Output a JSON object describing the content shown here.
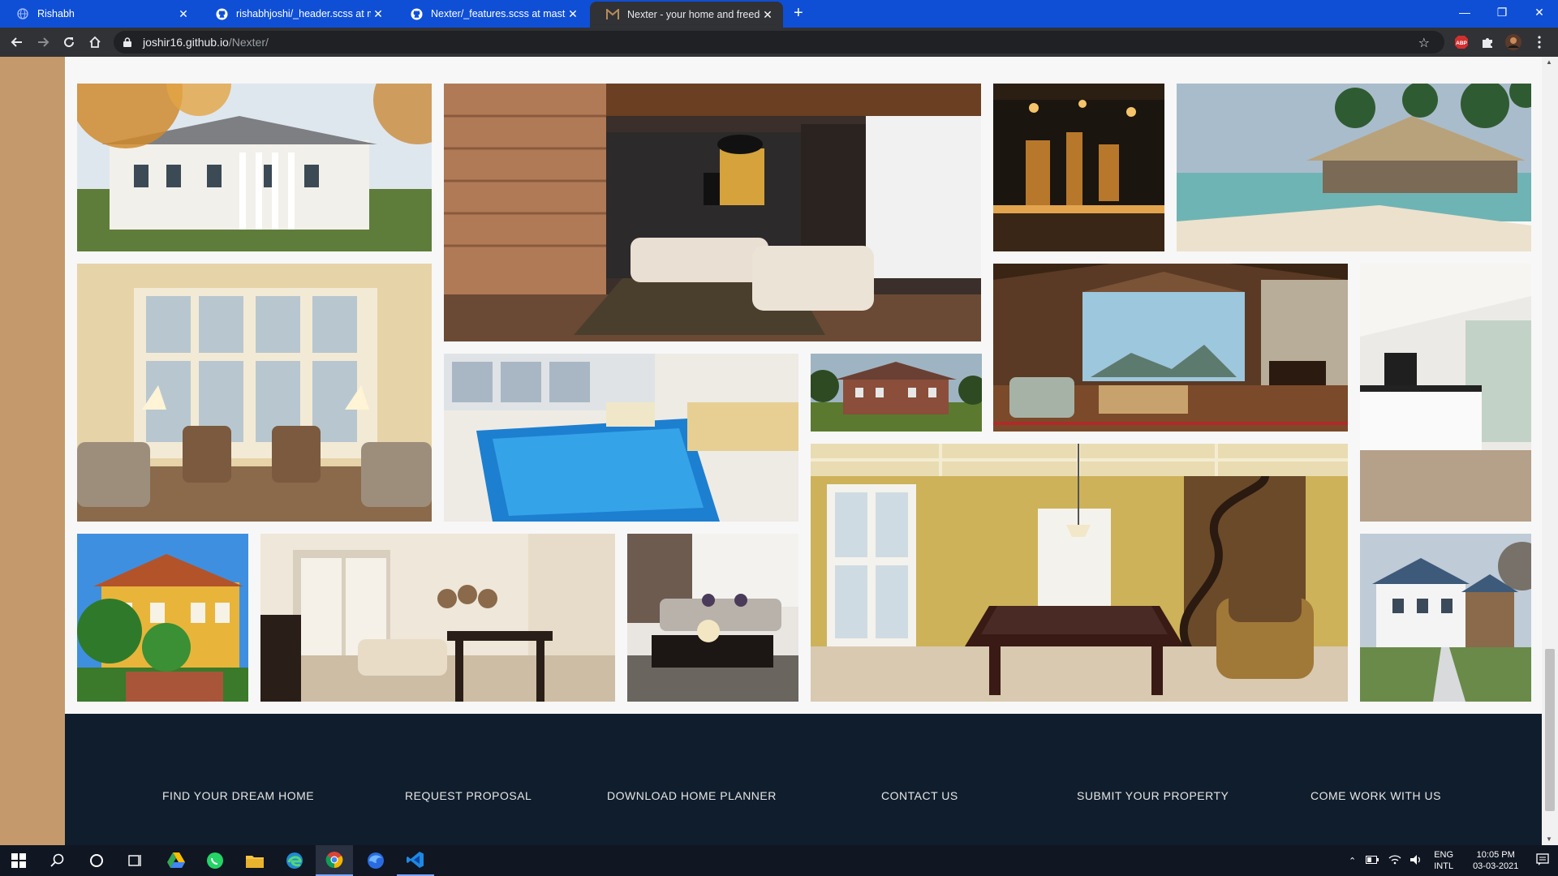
{
  "browser": {
    "tabs": [
      {
        "title": "Rishabh",
        "favicon": "globe-icon"
      },
      {
        "title": "rishabhjoshi/_header.scss at mas",
        "favicon": "github-icon"
      },
      {
        "title": "Nexter/_features.scss at master ·",
        "favicon": "github-icon"
      },
      {
        "title": "Nexter - your home and freedom",
        "favicon": "nexter-icon",
        "active": true
      }
    ],
    "url_host": "joshir16.github.io",
    "url_path": "/Nexter/",
    "extensions": [
      "ABP"
    ]
  },
  "gallery": {
    "images": [
      {
        "name": "gallery-image-1",
        "subject": "colonial-house-autumn"
      },
      {
        "name": "gallery-image-2",
        "subject": "living-room-wood-ceiling"
      },
      {
        "name": "gallery-image-3",
        "subject": "dark-bar-interior"
      },
      {
        "name": "gallery-image-4",
        "subject": "beach-resort"
      },
      {
        "name": "gallery-image-5",
        "subject": "sunroom-armchairs"
      },
      {
        "name": "gallery-image-6",
        "subject": "indoor-pool"
      },
      {
        "name": "gallery-image-7",
        "subject": "brick-house"
      },
      {
        "name": "gallery-image-8",
        "subject": "great-room-stone-fireplace"
      },
      {
        "name": "gallery-image-9",
        "subject": "white-kitchen"
      },
      {
        "name": "gallery-image-10",
        "subject": "billiard-room"
      },
      {
        "name": "gallery-image-11",
        "subject": "mediterranean-villa"
      },
      {
        "name": "gallery-image-12",
        "subject": "dining-living-room"
      },
      {
        "name": "gallery-image-13",
        "subject": "modern-lounge"
      },
      {
        "name": "gallery-image-14",
        "subject": "white-house-driveway"
      }
    ]
  },
  "footer": {
    "links": [
      "FIND YOUR DREAM HOME",
      "REQUEST PROPOSAL",
      "DOWNLOAD HOME PLANNER",
      "CONTACT US",
      "SUBMIT YOUR PROPERTY",
      "COME WORK WITH US"
    ]
  },
  "taskbar": {
    "apps": [
      "start-icon",
      "search-icon",
      "cortana-icon",
      "task-view-icon",
      "google-drive-icon",
      "whatsapp-icon",
      "file-explorer-icon",
      "edge-icon",
      "chrome-icon",
      "firefox-icon",
      "vscode-icon"
    ],
    "lang_line1": "ENG",
    "lang_line2": "INTL",
    "time": "10:05 PM",
    "date": "03-03-2021"
  },
  "colors": {
    "tab_bar": "#0f4fd6",
    "toolbar": "#313235",
    "side_band": "#c49a6c",
    "footer": "#101d2c",
    "taskbar": "#101622"
  }
}
